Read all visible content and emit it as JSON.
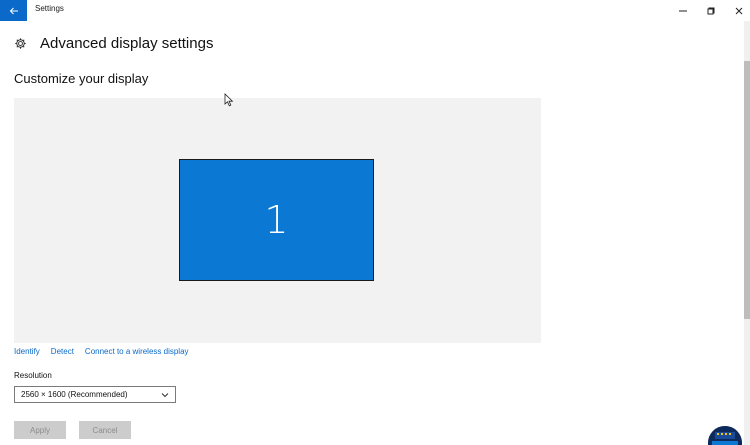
{
  "window": {
    "title": "Settings"
  },
  "header": {
    "title": "Advanced display settings",
    "icon": "gear-icon"
  },
  "section": {
    "title": "Customize your display"
  },
  "display_layout": {
    "monitor_label": "1",
    "monitor_color": "#0b78d4",
    "area_color": "#f2f2f2"
  },
  "links": {
    "identify": "Identify",
    "detect": "Detect",
    "connect": "Connect to a wireless display",
    "color": "#0b6ac9"
  },
  "resolution": {
    "label": "Resolution",
    "value": "2560 × 1600 (Recommended)"
  },
  "buttons": {
    "apply": "Apply",
    "cancel": "Cancel"
  },
  "colors": {
    "accent": "#0b6ac9"
  }
}
